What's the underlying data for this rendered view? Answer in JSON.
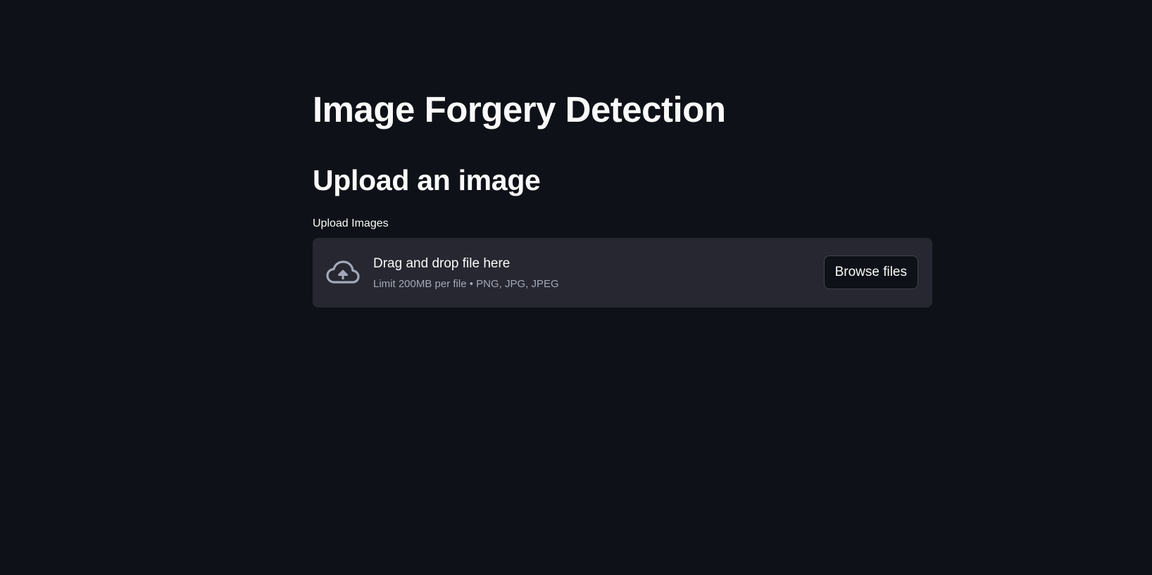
{
  "page": {
    "title": "Image Forgery Detection",
    "subtitle": "Upload an image"
  },
  "uploader": {
    "label": "Upload Images",
    "drop_text": "Drag and drop file here",
    "limit_text": "Limit 200MB per file • PNG, JPG, JPEG",
    "browse_label": "Browse files",
    "icon": "cloud-upload-icon"
  },
  "colors": {
    "background": "#0e1117",
    "dropzone": "#262730",
    "text": "#fafafa",
    "muted_text": "#a3a8b8"
  }
}
